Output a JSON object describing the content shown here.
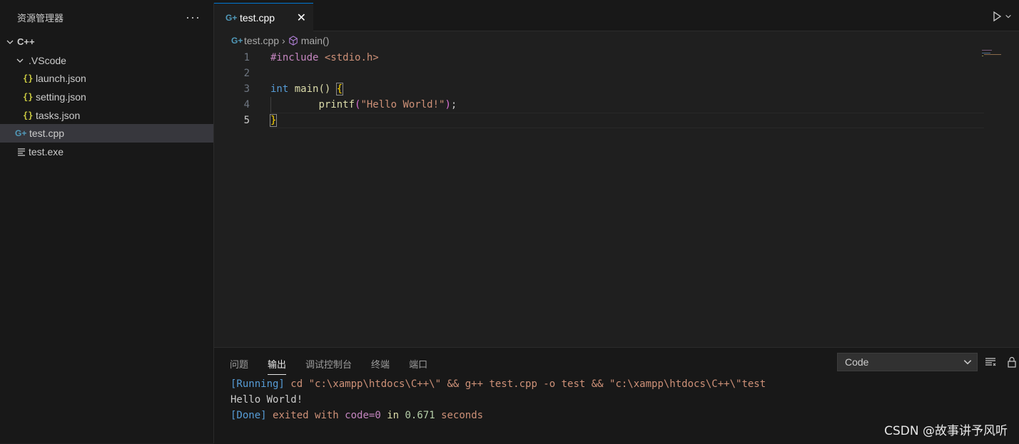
{
  "sidebar": {
    "title": "资源管理器",
    "more": "···",
    "root": "C++",
    "folder": ".VScode",
    "files": [
      {
        "name": "launch.json",
        "icon": "{}"
      },
      {
        "name": "setting.json",
        "icon": "{}"
      },
      {
        "name": "tasks.json",
        "icon": "{}"
      }
    ],
    "cpp_file": "test.cpp",
    "exe_file": "test.exe",
    "cpp_icon_glyph": "G+"
  },
  "tab": {
    "label": "test.cpp",
    "close": "✕"
  },
  "breadcrumb": {
    "file": "test.cpp",
    "symbol": "main()"
  },
  "editor": {
    "line_numbers": [
      "1",
      "2",
      "3",
      "4",
      "5"
    ],
    "active_line": "5",
    "line1_directive": "#include",
    "line1_header": "<stdio.h>",
    "line3_type": "int",
    "line3_func": "main",
    "line3_parens": "()",
    "line3_brace": "{",
    "line4_indent": "        ",
    "line4_func": "printf",
    "line4_open": "(",
    "line4_str": "\"Hello World!\"",
    "line4_close": ")",
    "line4_semi": ";",
    "line5_brace": "}"
  },
  "panel": {
    "tabs": [
      "问题",
      "输出",
      "调试控制台",
      "终端",
      "端口"
    ],
    "active_tab": "输出",
    "dropdown_value": "Code",
    "output": {
      "l1_tag": "[Running]",
      "l1_cmd": "cd \"c:\\xampp\\htdocs\\C++\\\" && g++ test.cpp -o test && \"c:\\xampp\\htdocs\\C++\\\"test",
      "l2": "Hello World!",
      "l3_tag": "[Done]",
      "l3_a": "exited with",
      "l3_code": "code=0",
      "l3_in": "in",
      "l3_num": "0.671",
      "l3_sec": "seconds"
    }
  },
  "watermark": "CSDN @故事讲予风听",
  "colors": {
    "background": "#1f1f1f",
    "sidebar": "#181818",
    "accent": "#0078d4",
    "json_icon": "#cbcb41",
    "cpp_icon": "#519aba"
  }
}
